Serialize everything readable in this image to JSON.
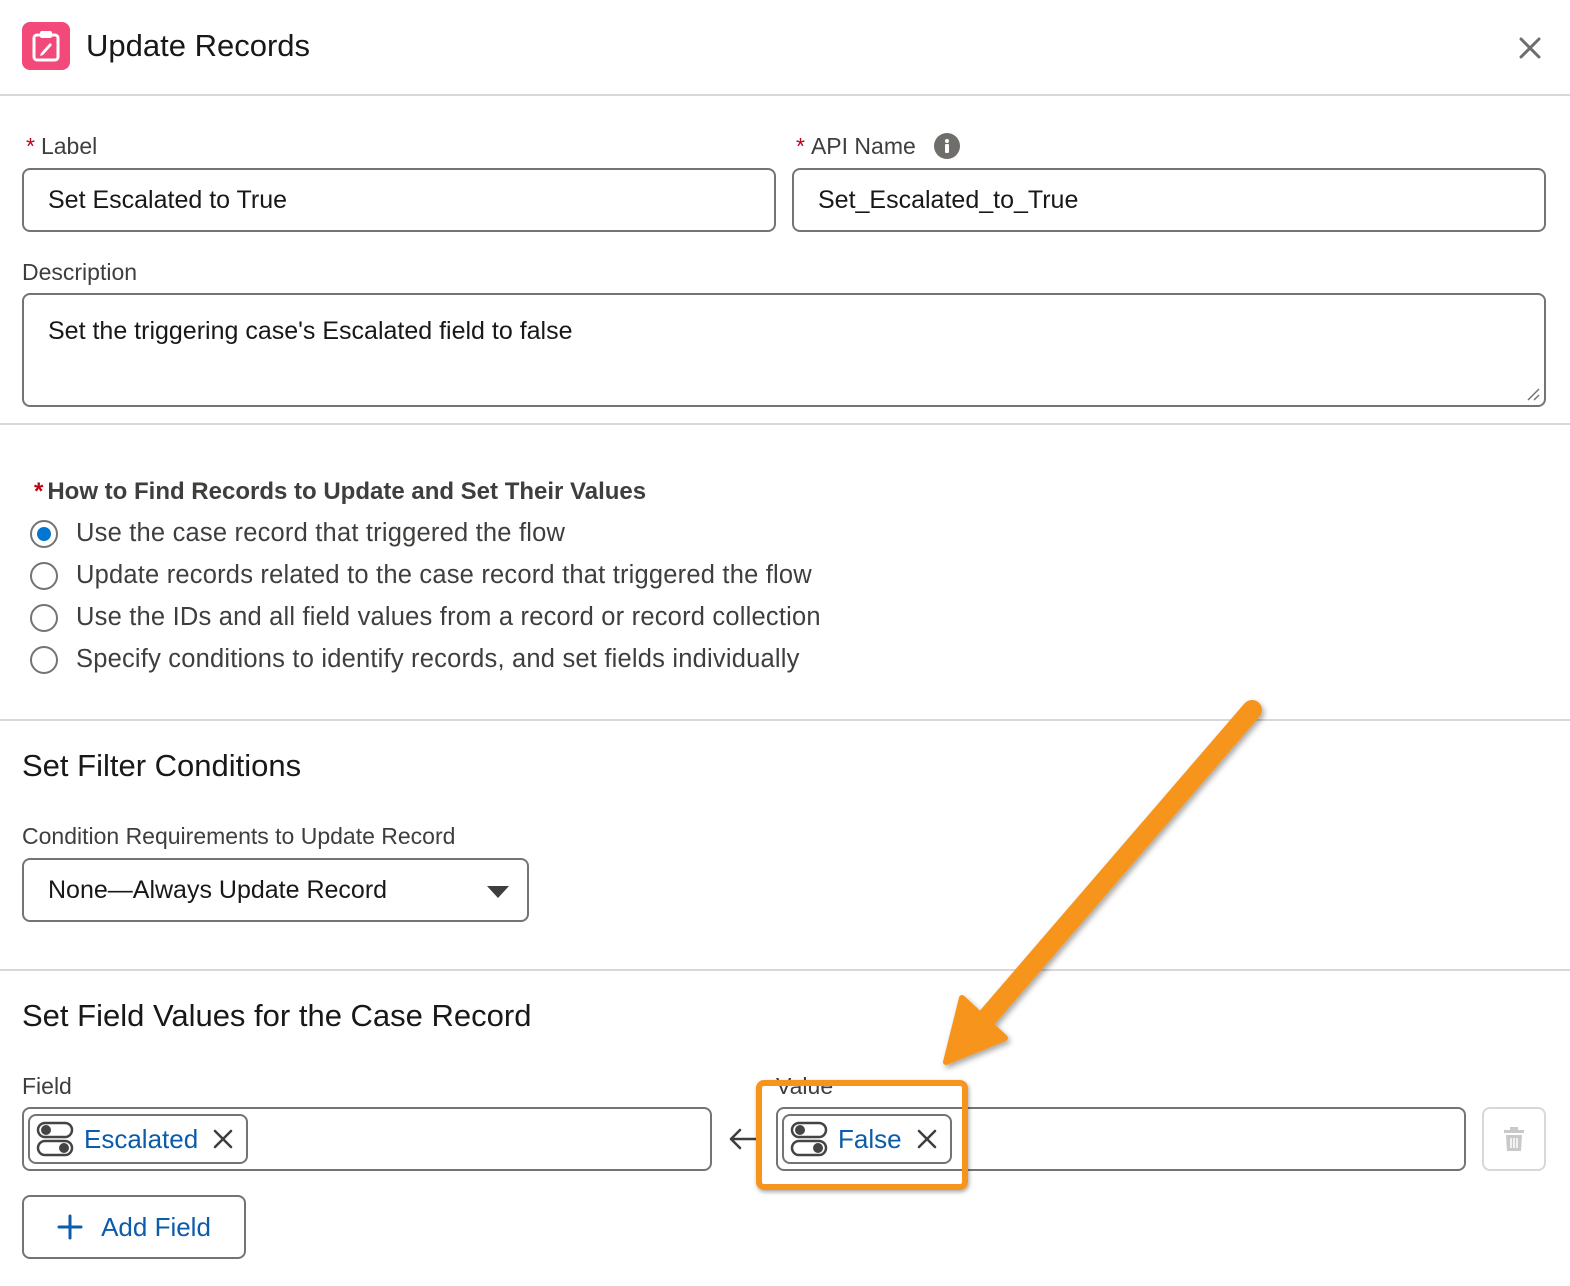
{
  "header": {
    "title": "Update Records",
    "close_icon": "close-icon",
    "app_icon": "clipboard-edit-icon"
  },
  "form": {
    "label": {
      "label": "Label",
      "value": "Set Escalated to True",
      "required": true
    },
    "api_name": {
      "label": "API Name",
      "value": "Set_Escalated_to_True",
      "required": true
    },
    "description": {
      "label": "Description",
      "value": "Set the triggering case's Escalated field to false"
    }
  },
  "find_records": {
    "title": "How to Find Records to Update and Set Their Values",
    "required": true,
    "options": [
      {
        "label": "Use the case record that triggered the flow",
        "selected": true
      },
      {
        "label": "Update records related to the case record that triggered the flow",
        "selected": false
      },
      {
        "label": "Use the IDs and all field values from a record or record collection",
        "selected": false
      },
      {
        "label": "Specify conditions to identify records, and set fields individually",
        "selected": false
      }
    ]
  },
  "filter": {
    "title": "Set Filter Conditions",
    "condition_label": "Condition Requirements to Update Record",
    "condition_value": "None—Always Update Record"
  },
  "field_values": {
    "title": "Set Field Values for the Case Record",
    "field_label": "Field",
    "value_label": "Value",
    "rows": [
      {
        "field": "Escalated",
        "value": "False"
      }
    ],
    "add_button": "Add Field"
  },
  "colors": {
    "brand_icon": "#f2497a",
    "link_blue": "#0b5cab",
    "radio_selected": "#0176d3",
    "annotation_orange": "#f7941d",
    "required_red": "#ba0517"
  }
}
